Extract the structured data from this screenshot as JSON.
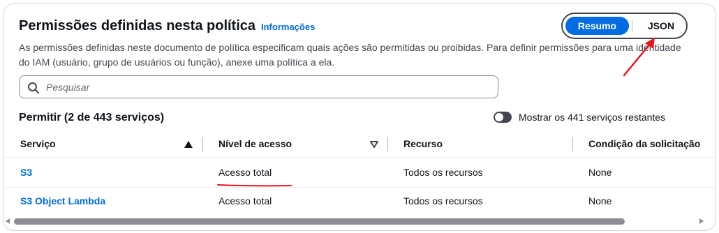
{
  "panel": {
    "title": "Permissões definidas nesta política",
    "info_link": "Informações",
    "description": "As permissões definidas neste documento de política especificam quais ações são permitidas ou proibidas. Para definir permissões para uma identidade do IAM (usuário, grupo de usuários ou função), anexe uma política a ela."
  },
  "view_toggle": {
    "options": [
      "Resumo",
      "JSON"
    ],
    "selected": "Resumo"
  },
  "search": {
    "placeholder": "Pesquisar",
    "value": ""
  },
  "summary": {
    "heading": "Permitir (2 de 443 serviços)",
    "show_remaining_label": "Mostrar os 441 serviços restantes",
    "show_remaining_enabled": false
  },
  "table": {
    "headers": [
      "Serviço",
      "Nível de acesso",
      "Recurso",
      "Condição da solicitação"
    ],
    "rows": [
      {
        "service": "S3",
        "access": "Acesso total",
        "resource": "Todos os recursos",
        "condition": "None"
      },
      {
        "service": "S3 Object Lambda",
        "access": "Acesso total",
        "resource": "Todos os recursos",
        "condition": "None"
      }
    ]
  },
  "colors": {
    "accent": "#006ce0",
    "annotation": "#e8141b",
    "text": "#0f141a"
  },
  "icons": {
    "search": "search-icon",
    "sort_asc": "sort-ascending-icon",
    "sort_desc": "sort-descending-icon"
  }
}
